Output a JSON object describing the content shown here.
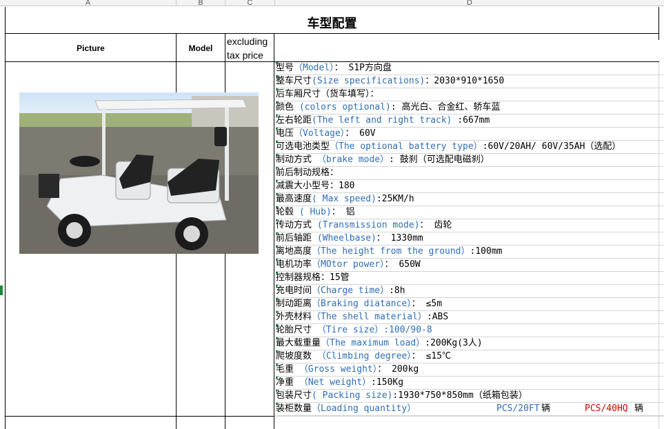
{
  "columns": [
    "A",
    "B",
    "C",
    "D"
  ],
  "title": "车型配置",
  "headers": {
    "picture": "Picture",
    "model": "Model",
    "price_line1": "excluding",
    "price_line2": "tax price"
  },
  "specs": [
    {
      "cn": "型号",
      "en": "（Model）",
      "sep": "：",
      "v": " S1P方向盘"
    },
    {
      "cn": "整车尺寸",
      "en": "(Size specifications)",
      "sep": "：",
      "v": "2030*910*1650"
    },
    {
      "cn": "后车厢尺寸（货车填写）：",
      "en": "",
      "sep": "",
      "v": ""
    },
    {
      "cn": "颜色 ",
      "en": "(colors optional)",
      "sep": ": ",
      "v": "高光白、合金红、轿车蓝"
    },
    {
      "cn": "左右轮距",
      "en": "(The left and right track)",
      "sep": "",
      "v": " :667mm"
    },
    {
      "cn": "电压",
      "en": "（Voltage）",
      "sep": "：",
      "v": " 60V"
    },
    {
      "cn": "可选电池类型",
      "en": "（The optional battery type）",
      "sep": "",
      "v": ":60V/20AH/ 60V/35AH（选配）"
    },
    {
      "cn": "制动方式 ",
      "en": "（brake mode）",
      "sep": ":",
      "v": " 鼓刹（可选配电磁刹）"
    },
    {
      "cn": "前后制动规格：",
      "en": "",
      "sep": "",
      "v": ""
    },
    {
      "cn": "减震大小型号：",
      "en": "",
      "sep": "",
      "v": "180"
    },
    {
      "cn": "最高速度",
      "en": "( Max speed)",
      "sep": "",
      "v": ":25KM/h"
    },
    {
      "cn": "轮毂 ",
      "en": " ( Hub)",
      "sep": "：",
      "v": " 铝"
    },
    {
      "cn": "传动方式 ",
      "en": "(Transmission mode)",
      "sep": "：",
      "v": " 齿轮"
    },
    {
      "cn": "前后轴距 ",
      "en": "(Wheelbase)",
      "sep": "：",
      "v": " 1330mm"
    },
    {
      "cn": "离地高度",
      "en": "（The height from the ground）",
      "sep": "",
      "v": ":100mm"
    },
    {
      "cn": "电机功率",
      "en": "（MOtor power）",
      "sep": "：",
      "v": " 650W"
    },
    {
      "cn": "控制器规格：",
      "en": "",
      "sep": "",
      "v": "15管"
    },
    {
      "cn": "充电时间",
      "en": "（Charge time）",
      "sep": "",
      "v": ":8h"
    },
    {
      "cn": "制动距离",
      "en": "（Braking diatance）",
      "sep": "：",
      "v": "  ≤5m"
    },
    {
      "cn": "外壳材料",
      "en": "（The shell material）",
      "sep": "",
      "v": ":ABS"
    },
    {
      "cn": "轮胎尺寸 ",
      "en": "（Tire size）:100/90-8",
      "sep": "",
      "v": ""
    },
    {
      "cn": "最大载重量",
      "en": "（The maximum load）",
      "sep": "",
      "v": ":200Kg(3人)"
    },
    {
      "cn": "爬坡度数 ",
      "en": "（Climbing degree）",
      "sep": "：",
      "v": "    ≤15℃"
    },
    {
      "cn": "毛重 ",
      "en": "（Gross weight）",
      "sep": "：",
      "v": " 200kg"
    },
    {
      "cn": "净重 ",
      "en": "（Net weight）",
      "sep": "",
      "v": ":150Kg"
    },
    {
      "cn": "包装尺寸",
      "en": "( Packing size)",
      "sep": "",
      "v": ":1930*750*850mm（纸箱包装）"
    }
  ],
  "loading": {
    "cn": "装柜数量",
    "en": "（Loading quantity）",
    "pcs20": "PCS/20FT",
    "unit1": " 辆",
    "pcs40": "PCS/40HQ",
    "unit2": " 辆"
  },
  "colors": {
    "english_text": "#2f6db4",
    "highlight_red": "#d40000",
    "cell_marker": "#1b8a3a"
  }
}
